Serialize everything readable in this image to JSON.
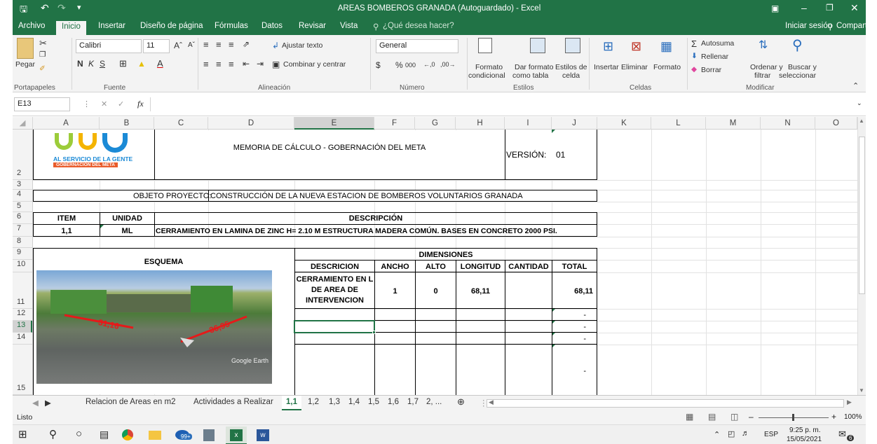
{
  "window": {
    "title": "AREAS BOMBEROS GRANADA (Autoguardado) - Excel"
  },
  "menu_tabs": [
    "Archivo",
    "Inicio",
    "Insertar",
    "Diseño de página",
    "Fórmulas",
    "Datos",
    "Revisar",
    "Vista"
  ],
  "tell_me": "¿Qué desea hacer?",
  "account": {
    "signin": "Iniciar sesión",
    "share": "Compartir"
  },
  "ribbon": {
    "paste": "Pegar",
    "font_name": "Calibri",
    "font_size": "11",
    "wrap": "Ajustar texto",
    "merge": "Combinar y centrar",
    "format_select": "General",
    "percent": "%",
    "thousands": "000",
    "cond_format_1": "Formato",
    "cond_format_2": "condicional",
    "format_table_1": "Dar formato",
    "format_table_2": "como tabla",
    "cell_styles_1": "Estilos de",
    "cell_styles_2": "celda",
    "insert": "Insertar",
    "delete": "Eliminar",
    "format": "Formato",
    "autosum": "Autosuma",
    "fill": "Rellenar",
    "clear": "Borrar",
    "sort_1": "Ordenar y",
    "sort_2": "filtrar",
    "find_1": "Buscar y",
    "find_2": "seleccionar",
    "groups": {
      "clipboard": "Portapapeles",
      "font": "Fuente",
      "alignment": "Alineación",
      "number": "Número",
      "styles": "Estilos",
      "cells": "Celdas",
      "editing": "Modificar"
    }
  },
  "formula_bar": {
    "name_box": "E13",
    "fx": "fx",
    "content": ""
  },
  "columns": [
    "A",
    "B",
    "C",
    "D",
    "E",
    "F",
    "G",
    "H",
    "I",
    "J",
    "K",
    "L",
    "M",
    "N",
    "O"
  ],
  "rows": [
    "2",
    "3",
    "4",
    "5",
    "6",
    "7",
    "8",
    "9",
    "10",
    "11",
    "12",
    "13",
    "14",
    "15"
  ],
  "sheet": {
    "logo_line1": "AL SERVICIO DE LA GENTE",
    "logo_line2": "GOBERNACIÓN DEL META",
    "header_title": "MEMORIA DE CÁLCULO - GOBERNACIÓN DEL META",
    "version_label": "VERSIÓN:",
    "version_value": "01",
    "object_label": "OBJETO PROYECTO:",
    "object_value": "CONSTRUCCIÓN DE LA NUEVA ESTACION DE BOMBEROS VOLUNTARIOS GRANADA",
    "item_h": "ITEM",
    "unit_h": "UNIDAD",
    "desc_h": "DESCRIPCIÓN",
    "item": "1,1",
    "unit": "ML",
    "desc": "CERRAMIENTO EN LAMINA DE ZINC H= 2.10 M ESTRUCTURA MADERA COMÚN. BASES EN CONCRETO 2000 PSI.",
    "esquema": "ESQUEMA",
    "dimensiones": "DIMENSIONES",
    "dim_headers": [
      "DESCRICION",
      "ANCHO",
      "ALTO",
      "LONGITUD",
      "CANTIDAD",
      "TOTAL"
    ],
    "desc_lines": [
      "CERRAMIENTO EN L",
      "DE AREA DE",
      "INTERVENCION"
    ],
    "ancho": "1",
    "alto": "0",
    "longitud": "68,11",
    "total": "68,11",
    "dash": "-",
    "photo_label1": "31,16",
    "photo_label2": "36,95",
    "photo_watermark": "Google Earth"
  },
  "sheet_tabs": [
    "Relacion de Areas en m2",
    "Actividades a Realizar",
    "1,1",
    "1,2",
    "1,3",
    "1,4",
    "1,5",
    "1,6",
    "1,7",
    "2, ..."
  ],
  "status": {
    "ready": "Listo",
    "zoom": "100%"
  },
  "taskbar": {
    "lang": "ESP",
    "time": "9:25 p. m.",
    "date": "15/05/2021",
    "badge": "6",
    "edge_badge": "99+"
  }
}
